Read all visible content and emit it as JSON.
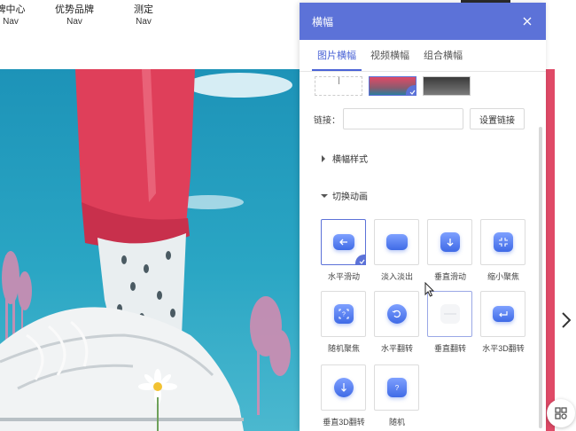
{
  "nav": {
    "items": [
      {
        "label": "牌中心",
        "sub": "Nav"
      },
      {
        "label": "优势品牌",
        "sub": "Nav"
      },
      {
        "label": "测定",
        "sub": "Nav"
      }
    ]
  },
  "panel": {
    "title": "横幅",
    "tabs": [
      "图片横幅",
      "视频横幅",
      "组合横幅"
    ],
    "link_label": "链接：",
    "link_value": "",
    "link_button": "设置链接",
    "section_style": "横幅样式",
    "section_anim": "切换动画",
    "animations": [
      {
        "label": "水平滑动",
        "icon": "arrow-left-icon",
        "selected": true
      },
      {
        "label": "淡入淡出",
        "icon": "fade-icon",
        "selected": false
      },
      {
        "label": "垂直滑动",
        "icon": "arrow-down-icon",
        "selected": false
      },
      {
        "label": "缩小聚焦",
        "icon": "shrink-focus-icon",
        "selected": false
      },
      {
        "label": "随机聚焦",
        "icon": "random-focus-icon",
        "selected": false
      },
      {
        "label": "水平翻转",
        "icon": "rotate-icon",
        "selected": false
      },
      {
        "label": "垂直翻转",
        "icon": "flip-vertical-icon",
        "selected": false
      },
      {
        "label": "水平3D翻转",
        "icon": "flip-3d-horizontal-icon",
        "selected": false
      },
      {
        "label": "垂直3D翻转",
        "icon": "flip-3d-vertical-icon",
        "selected": false
      },
      {
        "label": "随机",
        "icon": "random-icon",
        "selected": false
      }
    ]
  },
  "colors": {
    "accent": "#5c72d8",
    "hero_strip": "#e04a67"
  }
}
